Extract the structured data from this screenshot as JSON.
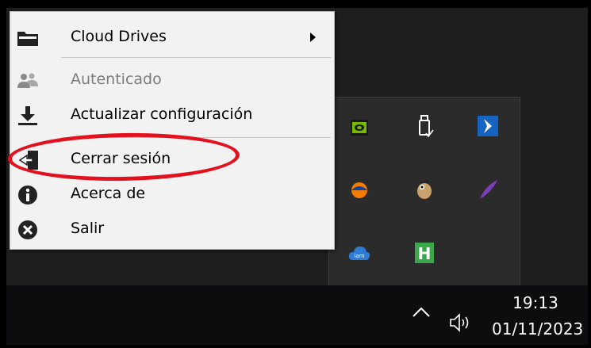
{
  "menu": {
    "items": [
      {
        "label": "Cloud Drives",
        "icon": "folder-icon",
        "submenu": true,
        "enabled": true
      },
      {
        "label": "Autenticado",
        "icon": "users-icon",
        "submenu": false,
        "enabled": false
      },
      {
        "label": "Actualizar configuración",
        "icon": "download-icon",
        "submenu": false,
        "enabled": true
      },
      {
        "label": "Cerrar sesión",
        "icon": "logout-icon",
        "submenu": false,
        "enabled": true,
        "highlighted_by_annotation": true
      },
      {
        "label": "Acerca de",
        "icon": "info-icon",
        "submenu": false,
        "enabled": true
      },
      {
        "label": "Salir",
        "icon": "exit-icon",
        "submenu": false,
        "enabled": true
      }
    ]
  },
  "annotation": {
    "shape": "ellipse",
    "color": "#e3101e",
    "target": "Cerrar sesión"
  },
  "tray": {
    "icons": [
      {
        "name": "nvidia-icon"
      },
      {
        "name": "usb-drive-icon"
      },
      {
        "name": "chevron-app-icon"
      },
      {
        "name": "orange-app-icon"
      },
      {
        "name": "bird-app-icon"
      },
      {
        "name": "feather-app-icon"
      },
      {
        "name": "cloud-iam-icon",
        "text": "iam"
      },
      {
        "name": "h-app-icon",
        "text": "H"
      }
    ]
  },
  "taskbar": {
    "time": "19:13",
    "date": "01/11/2023",
    "show_hidden_icon": "chevron-up-icon",
    "volume_icon": "speaker-icon"
  },
  "colors": {
    "menu_bg": "#f2f2f2",
    "disabled_text": "#7c7c7c",
    "taskbar_bg": "#0d0d0f",
    "tray_bg": "#2b2b2b",
    "annotation": "#e3101e"
  }
}
